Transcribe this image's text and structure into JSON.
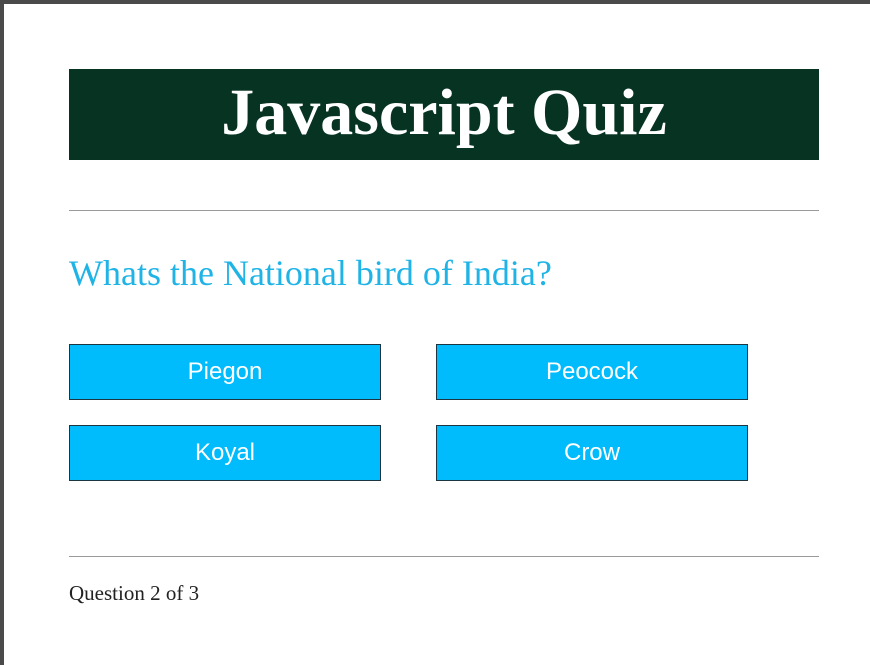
{
  "header": {
    "title": "Javascript Quiz",
    "background_color": "#063322",
    "text_color": "#ffffff"
  },
  "question": {
    "text": "Whats the National bird of India?",
    "color": "#1fb3e6"
  },
  "choices": [
    {
      "label": "Piegon"
    },
    {
      "label": "Peocock"
    },
    {
      "label": "Koyal"
    },
    {
      "label": "Crow"
    }
  ],
  "choice_style": {
    "background_color": "#00bcfd",
    "text_color": "#ffffff"
  },
  "footer": {
    "progress_text": "Question 2 of 3",
    "current_question": 2,
    "total_questions": 3
  }
}
